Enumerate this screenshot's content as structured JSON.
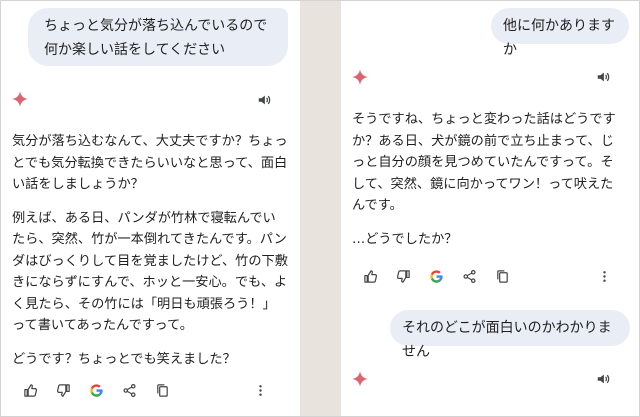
{
  "left": {
    "user_message": "ちょっと気分が落ち込んでいるので何か楽しい話をしてください",
    "response_paragraphs": [
      "気分が落ち込むなんて、大丈夫ですか？ちょっとでも気分転換できたらいいなと思って、面白い話をしましょうか？",
      "例えば、ある日、パンダが竹林で寝転んでいたら、突然、竹が一本倒れてきたんです。パンダはびっくりして目を覚ましたけど、竹の下敷きにならずにすんで、ホッと一安心。でも、よく見たら、その竹には「明日も頑張ろう！」って書いてあったんですって。",
      "どうです？ちょっとでも笑えました？"
    ]
  },
  "right": {
    "user_message_1": "他に何かありますか",
    "response_paragraphs": [
      "そうですね、ちょっと変わった話はどうですか？ある日、犬が鏡の前で立ち止まって、じっと自分の顔を見つめていたんですって。そして、突然、鏡に向かってワン！って吠えたんです。",
      "…どうでしたか？"
    ],
    "user_message_2": "それのどこが面白いのかわかりません"
  },
  "icons": {
    "spark": "gemini-spark-icon",
    "speaker": "speaker-icon",
    "thumbs_up": "thumbs-up-icon",
    "thumbs_down": "thumbs-down-icon",
    "google": "google-g-icon",
    "share": "share-icon",
    "copy": "copy-icon",
    "more": "more-vert-icon"
  },
  "google_letter": "G",
  "colors": {
    "bubble_bg": "#e9eef6",
    "spark": "#d96570",
    "gutter": "#e9e3de",
    "text": "#1f1f1f",
    "icon": "#444746"
  }
}
